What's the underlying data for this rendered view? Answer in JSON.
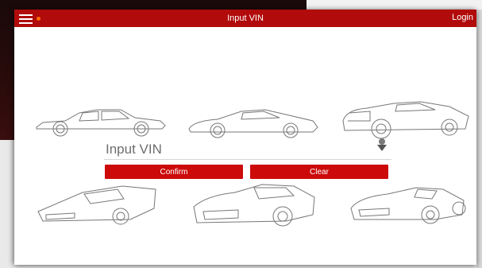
{
  "header": {
    "title": "Input VIN",
    "login_label": "Login",
    "menu_icon": "hamburger-menu-icon",
    "accent_color": "#b10b0b",
    "notification_color": "#ff6a00"
  },
  "vin": {
    "placeholder": "Input VIN",
    "value": ""
  },
  "buttons": {
    "confirm_label": "Confirm",
    "clear_label": "Clear",
    "color": "#cc0a0a"
  },
  "cars": [
    {
      "icon": "classic-coupe-icon"
    },
    {
      "icon": "sports-coupe-icon"
    },
    {
      "icon": "hot-rod-icon"
    },
    {
      "icon": "wedge-supercar-icon"
    },
    {
      "icon": "supercar-icon"
    },
    {
      "icon": "convertible-icon"
    }
  ]
}
